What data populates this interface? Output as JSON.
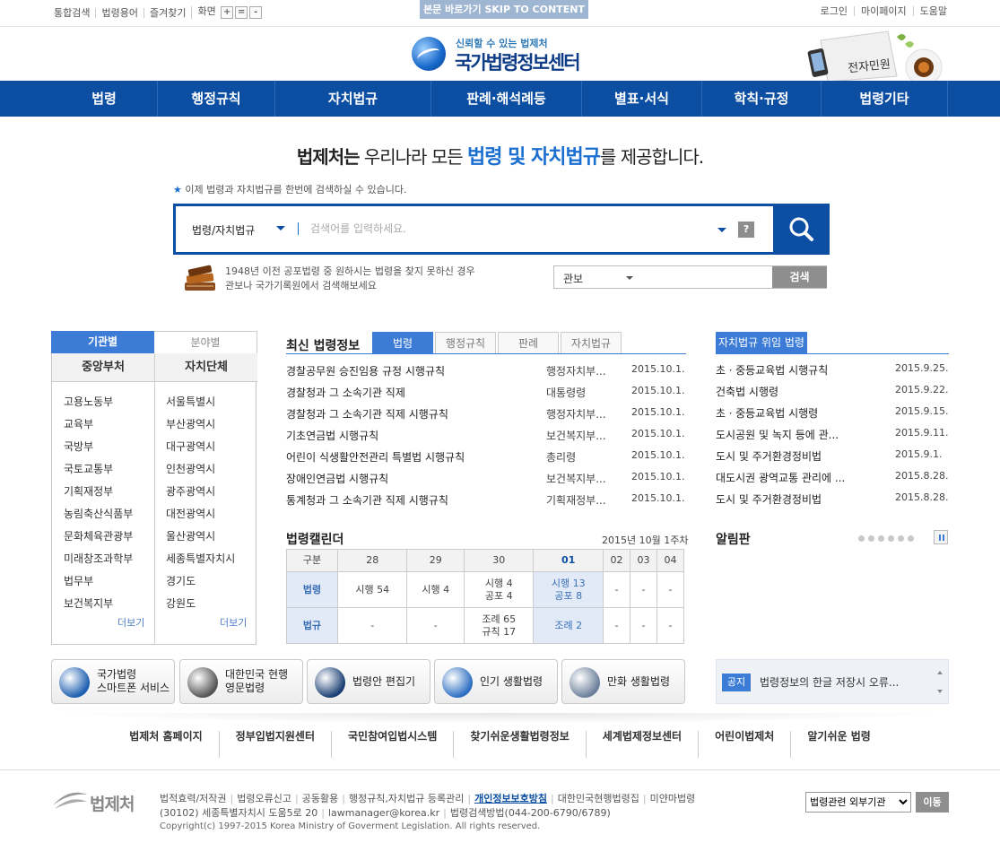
{
  "top_links": [
    "통합검색",
    "법령용어",
    "즐겨찾기",
    "화면"
  ],
  "zoom_buttons": [
    "+",
    "=",
    "-"
  ],
  "skip_link": "본문 바로가기 SKIP TO CONTENT",
  "right_links": [
    "로그인",
    "마이페이지",
    "도움말"
  ],
  "logo": {
    "tagline": "신뢰할 수 있는 법제처",
    "name": "국가법령정보센터"
  },
  "e_minwon": "전자민원",
  "nav": [
    "법령",
    "행정규칙",
    "자치법규",
    "판례·해석례등",
    "별표·서식",
    "학칙·규정",
    "법령기타"
  ],
  "headline": {
    "part1": "법제처는",
    "part2": " 우리나라 모든 ",
    "part3": "법령 및 자치법규",
    "part4": "를 제공합니다."
  },
  "search_hint": "이제 법령과 자치법규를 한번에 검색하실 수 있습니다.",
  "search": {
    "scope": "법령/자치법규",
    "placeholder": "검색어를 입력하세요.",
    "help": "?"
  },
  "old_laws": {
    "line1": "1948년 이전 공포법령 중 원하시는 법령을 찾지 못하신 경우",
    "line2": "관보나 국가기록원에서 검색해보세요"
  },
  "gwanbo": {
    "select": "관보",
    "button": "검색"
  },
  "agency_panel": {
    "tabs": [
      "기관별",
      "분야별"
    ],
    "col1_header": "중앙부처",
    "col2_header": "자치단체",
    "col1": [
      "고용노동부",
      "교육부",
      "국방부",
      "국토교통부",
      "기획재정부",
      "농림축산식품부",
      "문화체육관광부",
      "미래창조과학부",
      "법무부",
      "보건복지부"
    ],
    "col2": [
      "서울특별시",
      "부산광역시",
      "대구광역시",
      "인천광역시",
      "광주광역시",
      "대전광역시",
      "울산광역시",
      "세종특별자치시",
      "경기도",
      "강원도"
    ],
    "more": "더보기"
  },
  "new_laws": {
    "title": "최신 법령정보",
    "tabs": [
      "법령",
      "행정규칙",
      "판례",
      "자치법규"
    ],
    "rows": [
      {
        "title": "경찰공무원 승진임용 규정 시행규칙",
        "org": "행정자치부...",
        "date": "2015.10.1."
      },
      {
        "title": "경찰청과 그 소속기관 직제",
        "org": "대통령령",
        "date": "2015.10.1."
      },
      {
        "title": "경찰청과 그 소속기관 직제 시행규칙",
        "org": "행정자치부...",
        "date": "2015.10.1."
      },
      {
        "title": "기초연금법 시행규칙",
        "org": "보건복지부...",
        "date": "2015.10.1."
      },
      {
        "title": "어린이 식생활안전관리 특별법 시행규칙",
        "org": "총리령",
        "date": "2015.10.1."
      },
      {
        "title": "장애인연금법 시행규칙",
        "org": "보건복지부...",
        "date": "2015.10.1."
      },
      {
        "title": "통계청과 그 소속기관 직제 시행규칙",
        "org": "기획재정부...",
        "date": "2015.10.1."
      }
    ]
  },
  "delegated": {
    "title": "자치법규 위임 법령",
    "rows": [
      {
        "title": "초ㆍ중등교육법 시행규칙",
        "date": "2015.9.25."
      },
      {
        "title": "건축법 시행령",
        "date": "2015.9.22."
      },
      {
        "title": "초ㆍ중등교육법 시행령",
        "date": "2015.9.15."
      },
      {
        "title": "도시공원 및 녹지 등에 관...",
        "date": "2015.9.11."
      },
      {
        "title": "도시 및 주거환경정비법",
        "date": "2015.9.1."
      },
      {
        "title": "대도시권 광역교통 관리에 ...",
        "date": "2015.8.28."
      },
      {
        "title": "도시 및 주거환경정비법",
        "date": "2015.8.28."
      }
    ]
  },
  "calendar": {
    "title": "법령캘린더",
    "week": "2015년 10월 1주차",
    "corner": "구분",
    "days": [
      "28",
      "29",
      "30",
      "01",
      "02",
      "03",
      "04"
    ],
    "row1_label": "법령",
    "row1": [
      "시행 54",
      "시행 4",
      "시행 4\n공포 4",
      "시행 13\n공포 8",
      "-",
      "-",
      "-"
    ],
    "row2_label": "법규",
    "row2": [
      "-",
      "-",
      "조례 65\n규칙 17",
      "조례 2",
      "-",
      "-",
      "-"
    ]
  },
  "notice_title": "알림판",
  "quick": [
    {
      "label": "국가법령\n스마트폰 서비스",
      "icon": "globe-icon",
      "color": "#1d5fb0"
    },
    {
      "label": "대한민국 현행\n영문법령",
      "icon": "book-icon",
      "color": "#555555"
    },
    {
      "label": "법령안 편집기",
      "icon": "laptop-icon",
      "color": "#1b3f74"
    },
    {
      "label": "인기 생활법령",
      "icon": "thumbs-up-icon",
      "color": "#2d6fc2"
    },
    {
      "label": "만화 생활법령",
      "icon": "cartoon-icon",
      "color": "#6b7f9a"
    }
  ],
  "notice": {
    "badge": "공지",
    "text": "법령정보의 한글 저장시 오류..."
  },
  "footer_links": [
    "법제처 홈페이지",
    "정부입법지원센터",
    "국민참여입법시스템",
    "찾기쉬운생활법령정보",
    "세계법제정보센터",
    "어린이법제처",
    "알기쉬운 법령"
  ],
  "footer": {
    "logo": "법제처",
    "links": [
      "법적효력/저작권",
      "법령오류신고",
      "공동활용",
      "행정규칙,자치법규 등록관리",
      "개인정보보호방침",
      "대한민국현행법령집",
      "미얀마법령"
    ],
    "address": "(30102) 세종특별자치시 도움5로 20",
    "email": "lawmanager@korea.kr",
    "phone": "법령검색방법(044-200-6790/6789)",
    "copyright": "Copyright(c) 1997-2015 Korea Ministry of Goverment Legislation. All rights reserved.",
    "select": "법령관련 외부기관",
    "go": "이동"
  }
}
